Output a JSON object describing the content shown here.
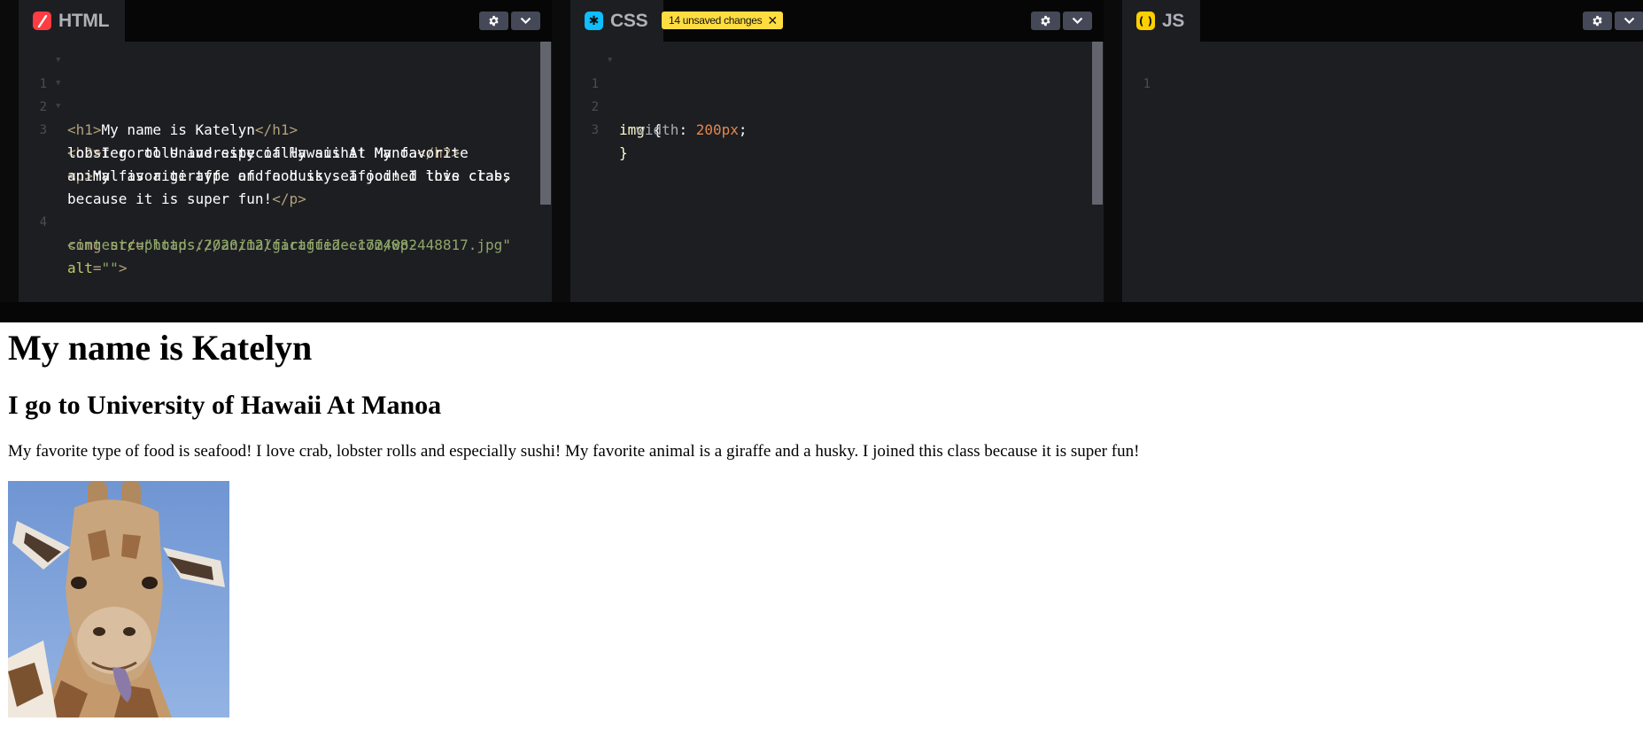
{
  "editors": {
    "html": {
      "tab_label": "HTML",
      "icon": "html-icon",
      "icon_color": "#ff3c41",
      "lines": {
        "n1": "1",
        "n2": "2",
        "n3": "3",
        "n4": "4",
        "l1_open": "<h1>",
        "l1_text": "My name is Katelyn",
        "l1_close": "</h1>",
        "l2_open": "<h2>",
        "l2_text": "I go to University of Hawaii At Manoa",
        "l2_close": "</h2>",
        "l3_open": "<p>",
        "l3_text_a": "My favorite type of food is seafood! I love crab,",
        "l3_text_b": "lobster rolls and especially sushi! My favorite",
        "l3_text_c": "animal is a giraffe and a husky. I joined this class",
        "l3_text_d": "because it is super fun!",
        "l3_close": "</p>",
        "l4_tag": "<img",
        "l4_attr_src": "src",
        "l4_eq": "=",
        "l4_src_a": "\"https://animalfactguide.com/wp-",
        "l4_src_b": "content/uploads/2020/12/giraffe2-e1724882448817.jpg\"",
        "l4_attr_alt": "alt",
        "l4_alt_val": "\"\"",
        "l4_close": ">"
      }
    },
    "css": {
      "tab_label": "CSS",
      "icon": "css-icon",
      "icon_color": "#0ebeff",
      "badge": "14 unsaved changes",
      "lines": {
        "n1": "1",
        "n2": "2",
        "n3": "3",
        "selector": "img",
        "brace_open": "{",
        "property": "width",
        "colon": ":",
        "value": "200px",
        "semi": ";",
        "brace_close": "}"
      }
    },
    "js": {
      "tab_label": "JS",
      "icon": "js-icon",
      "icon_color": "#fcd000",
      "lines": {
        "n1": "1"
      }
    }
  },
  "controls": {
    "settings_icon": "gear-icon",
    "menu_icon": "chevron-down-icon",
    "close_icon": "close-icon"
  },
  "preview": {
    "h1": "My name is Katelyn",
    "h2": "I go to University of Hawaii At Manoa",
    "paragraph": "My favorite type of food is seafood! I love crab, lobster rolls and especially sushi! My favorite animal is a giraffe and a husky. I joined this class because it is super fun!",
    "image_alt": "giraffe photo"
  }
}
